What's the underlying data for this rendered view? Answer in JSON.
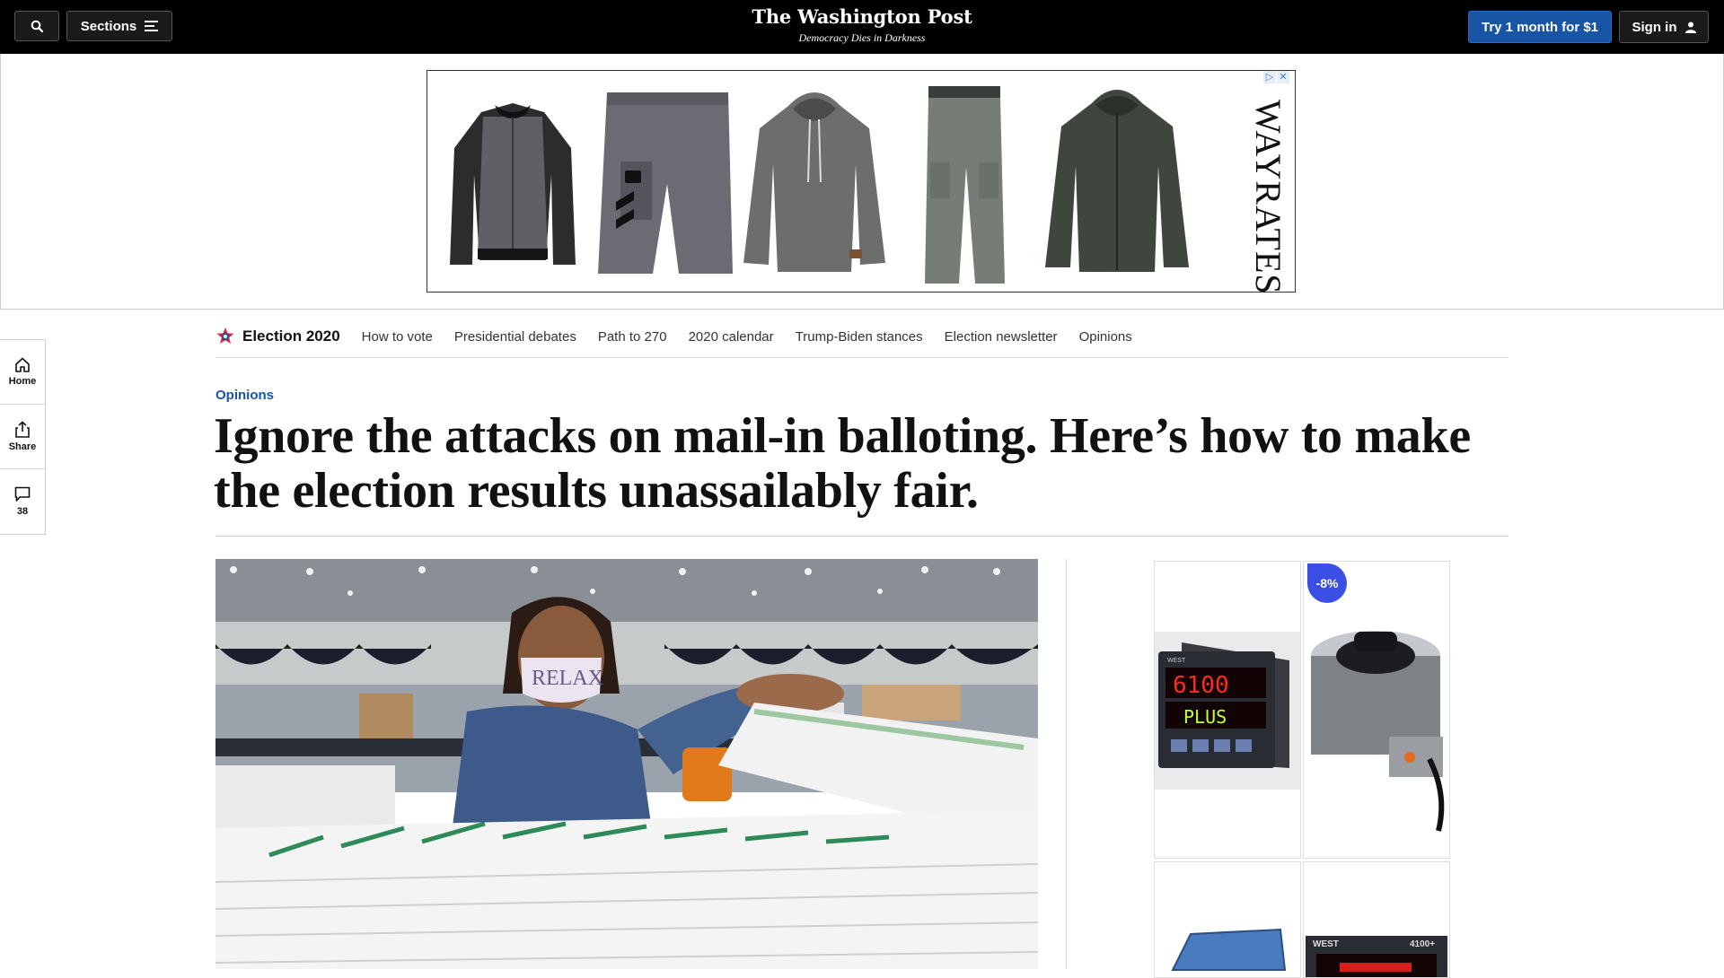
{
  "topbar": {
    "sections_label": "Sections",
    "logo": "The Washington Post",
    "tagline": "Democracy Dies in Darkness",
    "subscribe_label": "Try 1 month for $1",
    "signin_label": "Sign in"
  },
  "top_ad": {
    "advertiser": "WAYRATES",
    "products": [
      "varsity-jacket",
      "cargo-shorts",
      "knit-hoodie",
      "cargo-pants",
      "hooded-jacket"
    ]
  },
  "left_rail": {
    "home_label": "Home",
    "share_label": "Share",
    "comments_count": "38"
  },
  "election_nav": {
    "title": "Election 2020",
    "links": [
      "How to vote",
      "Presidential debates",
      "Path to 270",
      "2020 calendar",
      "Trump-Biden stances",
      "Election newsletter",
      "Opinions"
    ]
  },
  "article": {
    "kicker": "Opinions",
    "headline": "Ignore the attacks on mail-in balloting. Here’s how to make the election results unassailably fair."
  },
  "right_ad": {
    "discount_badge": "-8%",
    "products": [
      {
        "name": "temperature-controller",
        "display_top": "6100",
        "display_bottom": "PLUS",
        "brand": "WEST",
        "model": "6100+"
      },
      {
        "name": "variable-transformer"
      },
      {
        "name": "controller-box"
      },
      {
        "name": "controller-4100",
        "brand": "WEST",
        "model": "4100+"
      }
    ]
  },
  "colors": {
    "accent_blue": "#1955a5",
    "topbar": "#000000",
    "discount": "#3b4ee5"
  }
}
